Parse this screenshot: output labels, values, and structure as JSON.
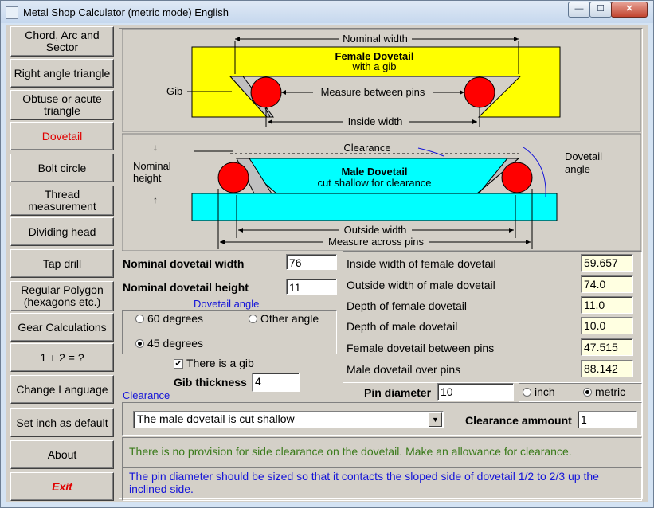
{
  "window": {
    "title": "Metal Shop Calculator (metric mode) English",
    "minimize": "—",
    "maximize": "☐",
    "close": "✕"
  },
  "nav": [
    {
      "key": "chord",
      "label1": "Chord, Arc and",
      "label2": "Sector"
    },
    {
      "key": "right-triangle",
      "label1": "Right angle triangle",
      "label2": ""
    },
    {
      "key": "obtuse",
      "label1": "Obtuse or acute",
      "label2": "triangle"
    },
    {
      "key": "dovetail",
      "label1": "Dovetail",
      "label2": ""
    },
    {
      "key": "bolt-circle",
      "label1": "Bolt circle",
      "label2": ""
    },
    {
      "key": "thread",
      "label1": "Thread",
      "label2": "measurement"
    },
    {
      "key": "dividing-head",
      "label1": "Dividing head",
      "label2": ""
    },
    {
      "key": "tap-drill",
      "label1": "Tap drill",
      "label2": ""
    },
    {
      "key": "polygon",
      "label1": "Regular Polygon",
      "label2": "(hexagons etc.)"
    },
    {
      "key": "gear",
      "label1": "Gear Calculations",
      "label2": ""
    },
    {
      "key": "calc",
      "label1": "1 + 2 = ?",
      "label2": ""
    },
    {
      "key": "language",
      "label1": "Change Language",
      "label2": ""
    },
    {
      "key": "inch-default",
      "label1": "Set inch as default",
      "label2": ""
    },
    {
      "key": "about",
      "label1": "About",
      "label2": ""
    },
    {
      "key": "exit",
      "label1": "Exit",
      "label2": ""
    }
  ],
  "diagram": {
    "nominal_width": "Nominal width",
    "female_title": "Female Dovetail",
    "female_sub": "with a gib",
    "gib": "Gib",
    "measure_between": "Measure between pins",
    "inside_width": "Inside width",
    "clearance": "Clearance",
    "nominal_height_1": "Nominal",
    "nominal_height_2": "height",
    "dovetail_angle_1": "Dovetail",
    "dovetail_angle_2": "angle",
    "male_title": "Male Dovetail",
    "male_sub": "cut shallow for clearance",
    "outside_width": "Outside width",
    "measure_across": "Measure across pins",
    "colors": {
      "female": "#ffff00",
      "male": "#00ffff",
      "pin": "#ff0000",
      "gib": "#c0c0c0"
    }
  },
  "inputs": {
    "nominal_width_label": "Nominal dovetail width",
    "nominal_width_value": "76",
    "nominal_height_label": "Nominal dovetail height",
    "nominal_height_value": "11",
    "angle_group_label": "Dovetail angle",
    "angle_60": "60 degrees",
    "angle_other": "Other angle",
    "angle_45": "45 degrees",
    "gib_check_label": "There is a gib",
    "gib_thickness_label": "Gib thickness",
    "gib_thickness_value": "4",
    "clearance_label": "Clearance",
    "clearance_select_value": "The male dovetail is cut shallow",
    "clearance_amount_label": "Clearance ammount",
    "clearance_amount_value": "1",
    "pin_diameter_label": "Pin diameter",
    "pin_diameter_value": "10",
    "unit_inch": "inch",
    "unit_metric": "metric"
  },
  "results": [
    {
      "label": "Inside width of female dovetail",
      "value": "59.657"
    },
    {
      "label": "Outside width of male dovetail",
      "value": "74.0"
    },
    {
      "label": "Depth of female dovetail",
      "value": "11.0"
    },
    {
      "label": "Depth of male dovetail",
      "value": "10.0"
    },
    {
      "label": "Female dovetail between pins",
      "value": "47.515"
    },
    {
      "label": "Male dovetail over pins",
      "value": "88.142"
    }
  ],
  "messages": {
    "note_green": "There is no provision for side clearance on the dovetail. Make an allowance for clearance.",
    "note_blue_1": "The pin diameter should be sized so that it contacts the sloped side of dovetail 1/2 to 2/3 up the",
    "note_blue_2": "inclined side.",
    "green_color": "#3a7a1a",
    "blue_color": "#1414d8"
  }
}
